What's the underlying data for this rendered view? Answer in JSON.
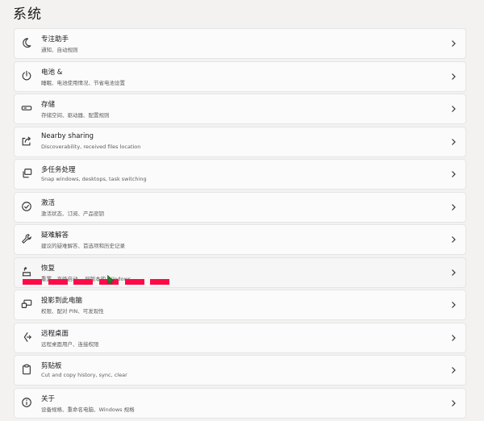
{
  "page": {
    "title": "系统"
  },
  "items": [
    {
      "icon": "moon-icon",
      "title": "专注助手",
      "subtitle": "通知、自动规则"
    },
    {
      "icon": "power-icon",
      "title": "电池 &",
      "subtitle": "睡眠、电池使用情况、节省电池设置"
    },
    {
      "icon": "storage-icon",
      "title": "存储",
      "subtitle": "存储空间、驱动器、配置规则"
    },
    {
      "icon": "share-icon",
      "title": "Nearby sharing",
      "subtitle": "Discoverability, received files location"
    },
    {
      "icon": "multitask-icon",
      "title": "多任务处理",
      "subtitle": "Snap windows, desktops, task switching"
    },
    {
      "icon": "check-circle-icon",
      "title": "激活",
      "subtitle": "激活状态、订阅、产品密钥"
    },
    {
      "icon": "wrench-icon",
      "title": "疑难解答",
      "subtitle": "建议的疑难解答、首选项和历史记录"
    },
    {
      "icon": "recovery-icon",
      "title": "恢复",
      "subtitle": "重置、高级启动、 旧版本的 Windows"
    },
    {
      "icon": "project-icon",
      "title": "投影到此电脑",
      "subtitle": "权限、配对 PIN、可发现性"
    },
    {
      "icon": "remote-desktop-icon",
      "title": "远程桌面",
      "subtitle": "远程桌面用户、连接权限"
    },
    {
      "icon": "clipboard-icon",
      "title": "剪贴板",
      "subtitle": "Cut and copy history, sync, clear"
    },
    {
      "icon": "info-icon",
      "title": "关于",
      "subtitle": "设备规格、重命名电脑、Windows 规格"
    }
  ],
  "colors": {
    "redaction": "#ff0a47",
    "cursor": "#2e7d32"
  }
}
